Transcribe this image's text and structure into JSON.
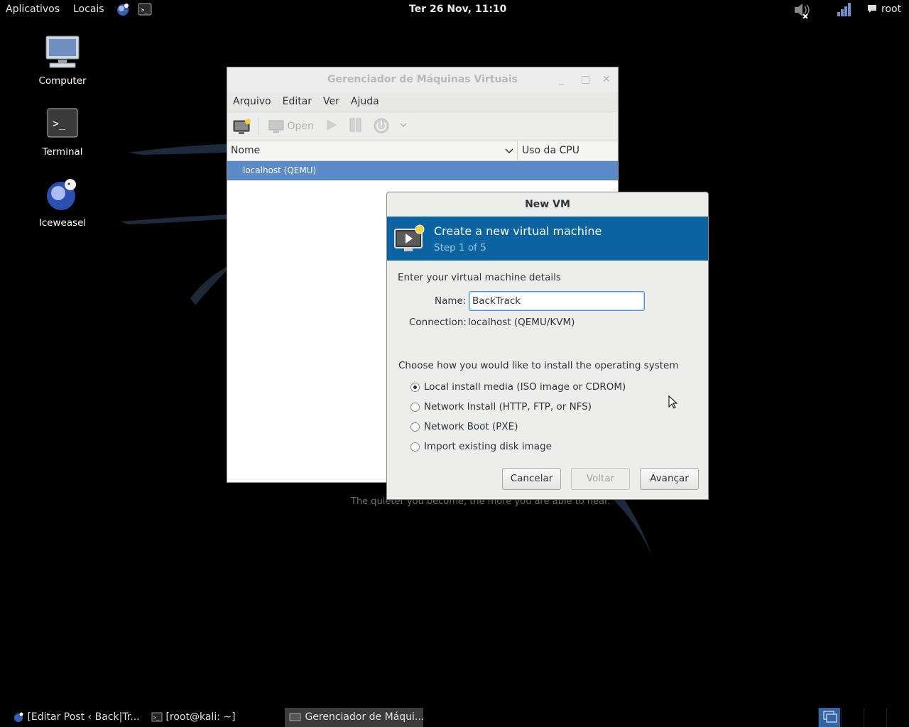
{
  "top_panel": {
    "apps_label": "Aplicativos",
    "places_label": "Locais",
    "clock": "Ter 26 Nov, 11:10",
    "user": "root",
    "icons": [
      "iceweasel-icon",
      "terminal-icon",
      "volume-muted-icon",
      "network-signal-icon",
      "chat-icon"
    ]
  },
  "desktop": {
    "icons": [
      {
        "label": "Computer",
        "icon": "computer-icon"
      },
      {
        "label": "Terminal",
        "icon": "terminal-icon"
      },
      {
        "label": "Iceweasel",
        "icon": "iceweasel-icon"
      }
    ],
    "wallpaper_quote": "The quieter you become, the more you are able to hear."
  },
  "vmm": {
    "title": "Gerenciador de Máquinas Virtuais",
    "menu": [
      "Arquivo",
      "Editar",
      "Ver",
      "Ajuda"
    ],
    "toolbar_open": "Open",
    "col_name": "Nome",
    "col_cpu": "Uso da CPU",
    "rows": [
      {
        "label": "localhost (QEMU)"
      }
    ]
  },
  "dialog": {
    "title": "New VM",
    "banner_title": "Create a new virtual machine",
    "banner_step": "Step 1 of 5",
    "details_heading": "Enter your virtual machine details",
    "name_label": "Name:",
    "name_value": "BackTrack",
    "connection_label": "Connection:",
    "connection_value": "localhost (QEMU/KVM)",
    "install_heading": "Choose how you would like to install the operating system",
    "options": [
      {
        "label": "Local install media (ISO image or CDROM)",
        "selected": true
      },
      {
        "label": "Network Install (HTTP, FTP, or NFS)",
        "selected": false
      },
      {
        "label": "Network Boot (PXE)",
        "selected": false
      },
      {
        "label": "Import existing disk image",
        "selected": false
      }
    ],
    "buttons": {
      "cancel": "Cancelar",
      "back": "Voltar",
      "forward": "Avançar"
    }
  },
  "taskbar": {
    "tasks": [
      {
        "label": "[Editar Post ‹ Back|Tr...",
        "active": false
      },
      {
        "label": "[root@kali: ~]",
        "active": false
      },
      {
        "label": "Gerenciador de Máqui...",
        "active": true
      }
    ]
  },
  "colors": {
    "selection": "#5b8bc9",
    "banner": "#0b63a1",
    "workspace_active": "#3465a4"
  }
}
